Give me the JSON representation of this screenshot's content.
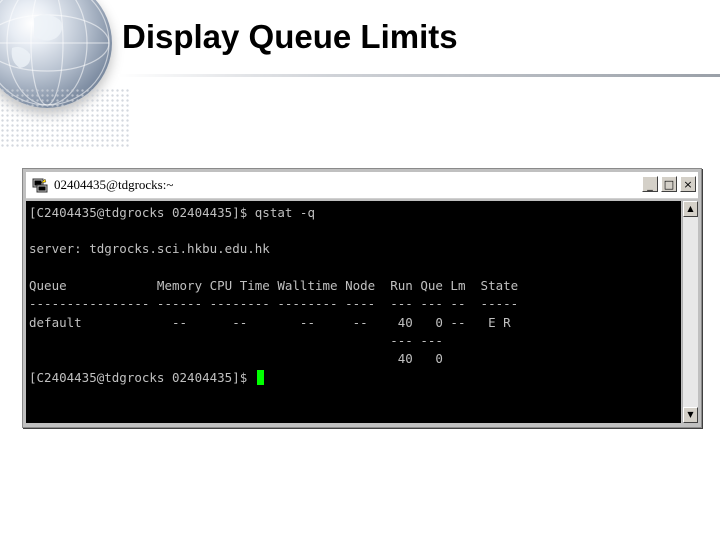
{
  "slide": {
    "title": "Display Queue Limits"
  },
  "window": {
    "title": "02404435@tdgrocks:~",
    "minimize_glyph": "_",
    "maximize_glyph": "□",
    "close_glyph": "×",
    "scroll_up_glyph": "▲",
    "scroll_down_glyph": "▼"
  },
  "terminal": {
    "lines": [
      "[C2404435@tdgrocks 02404435]$ qstat -q",
      "",
      "server: tdgrocks.sci.hkbu.edu.hk",
      "",
      "Queue            Memory CPU Time Walltime Node  Run Que Lm  State",
      "---------------- ------ -------- -------- ----  --- --- --  -----",
      "default            --      --       --     --    40   0 --   E R",
      "                                                --- ---",
      "                                                 40   0",
      "",
      "[C2404435@tdgrocks 02404435]$ "
    ]
  },
  "colors": {
    "terminal_bg": "#000000",
    "terminal_fg": "#c0c0c0",
    "cursor": "#00ff00"
  }
}
